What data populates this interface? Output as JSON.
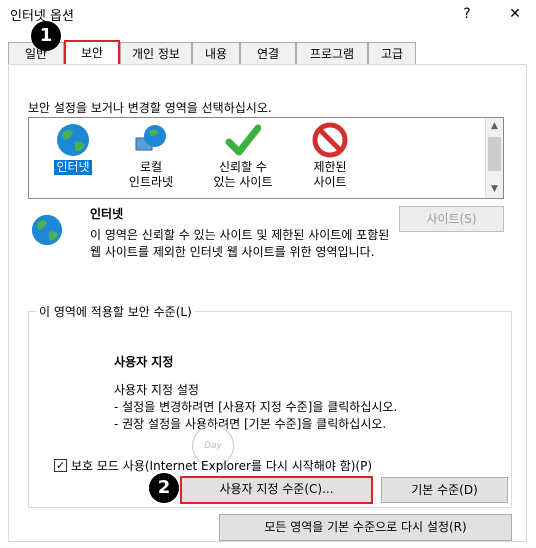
{
  "window": {
    "title": "인터넷 옵션",
    "help_label": "?",
    "close_label": "✕"
  },
  "tabs": [
    {
      "label": "일반"
    },
    {
      "label": "보안"
    },
    {
      "label": "개인 정보"
    },
    {
      "label": "내용"
    },
    {
      "label": "연결"
    },
    {
      "label": "프로그램"
    },
    {
      "label": "고급"
    }
  ],
  "badges": {
    "one": "1",
    "two": "2"
  },
  "security": {
    "prompt": "보안 설정을 보거나 변경할 영역을 선택하십시오.",
    "zones": [
      {
        "line1": "인터넷",
        "line2": "",
        "icon": "globe-icon"
      },
      {
        "line1": "로컬",
        "line2": "인트라넷",
        "icon": "intranet-globe-icon"
      },
      {
        "line1": "신뢰할 수",
        "line2": "있는 사이트",
        "icon": "checkmark-icon"
      },
      {
        "line1": "제한된",
        "line2": "사이트",
        "icon": "restricted-icon"
      }
    ],
    "selected_zone": {
      "name": "인터넷",
      "description": "이 영역은 신뢰할 수 있는 사이트 및 제한된 사이트에 포함된 웹 사이트를 제외한 인터넷 웹 사이트를 위한 영역입니다."
    },
    "sites_button": "사이트(S)"
  },
  "level_group": {
    "label": "이 영역에 적용할 보안 수준(L)",
    "heading": "사용자 지정",
    "subtitle": "사용자 지정 설정",
    "bullet1": "- 설정을 변경하려면 [사용자 지정 수준]을 클릭하십시오.",
    "bullet2": "- 권장 설정을 사용하려면 [기본 수준]을 클릭하십시오.",
    "protected_mode_label": "보호 모드 사용(Internet Explorer를 다시 시작해야 함)(P)",
    "protected_mode_checked": true,
    "custom_level_button": "사용자 지정 수준(C)...",
    "default_level_button": "기본 수준(D)"
  },
  "reset_all_button": "모든 영역을 기본 수준으로 다시 설정(R)",
  "watermark_text": "Day",
  "colors": {
    "highlight": "#e0202a",
    "selection": "#0078d7"
  }
}
